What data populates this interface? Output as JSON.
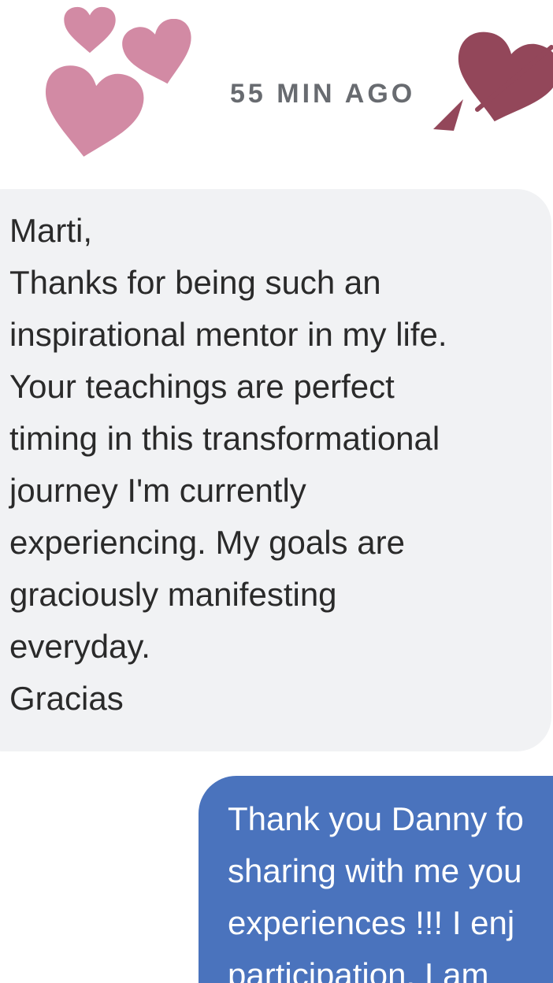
{
  "header": {
    "timestamp": "55 MIN AGO",
    "icons": [
      "heart-small-icon",
      "heart-medium-icon",
      "heart-large-icon",
      "heart-arrow-icon"
    ],
    "colors": {
      "pink_heart": "#d28aa4",
      "dark_heart": "#93475a",
      "timestamp_text": "#686b70"
    }
  },
  "messages": {
    "received": {
      "lines": [
        "Marti,",
        "Thanks for being such an",
        "inspirational mentor in my life.",
        "Your teachings are perfect",
        "timing in this transformational",
        "journey I'm currently",
        "experiencing. My goals are",
        "graciously manifesting",
        "everyday.",
        "Gracias"
      ],
      "bubble_color": "#f1f2f4",
      "text_color": "#2a2a2a"
    },
    "sent": {
      "lines": [
        "Thank you Danny fo",
        "sharing with me you",
        "experiences !!! I enj",
        "participation.  I am"
      ],
      "bubble_color": "#4a73bd",
      "text_color": "#ffffff"
    }
  }
}
